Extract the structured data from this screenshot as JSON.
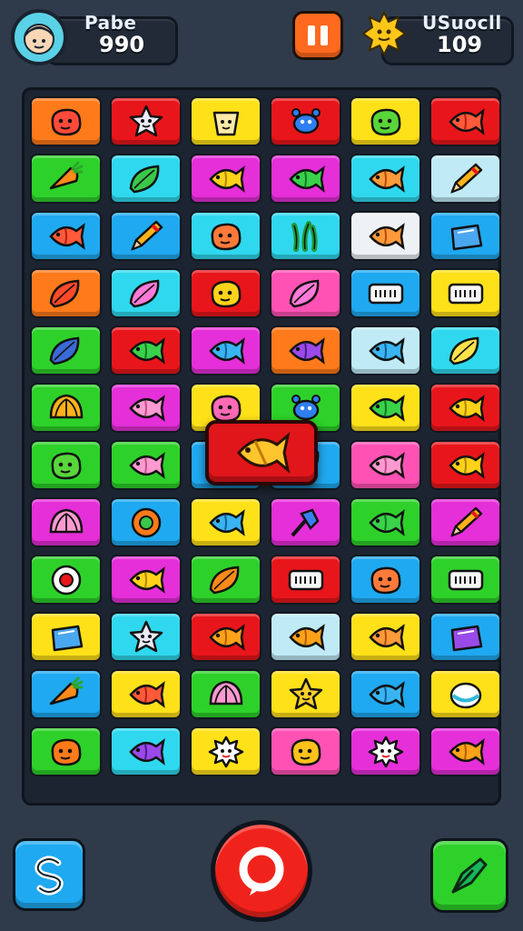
{
  "hud": {
    "player": {
      "name": "Pabe",
      "score": "990",
      "avatar_icon": "player-avatar-icon"
    },
    "pause_icon": "pause-icon",
    "opponent": {
      "name": "USuocll",
      "score": "109",
      "coin_icon": "sun-coin-icon"
    }
  },
  "colors": {
    "background": "#2f3b4b",
    "orange": "#ff7a1a",
    "red": "#e8161b",
    "yellow": "#ffe119",
    "green": "#2ed12a",
    "cyan": "#2fd8ee",
    "blue": "#1fa9f0",
    "magenta": "#e52fd8",
    "pink": "#ff52b4",
    "sky": "#bfeaf6",
    "white": "#eef2f5"
  },
  "board": {
    "rows": 12,
    "cols": 6,
    "tiles": [
      [
        [
          "orange",
          "tomato-icon"
        ],
        [
          "red",
          "paper-star-icon"
        ],
        [
          "yellow",
          "bucket-face-icon"
        ],
        [
          "red",
          "blue-crab-icon"
        ],
        [
          "yellow",
          "green-blob-icon"
        ],
        [
          "red",
          "red-fish-icon"
        ]
      ],
      [
        [
          "green",
          "carrot-icon"
        ],
        [
          "cyan",
          "leaf-fish-icon"
        ],
        [
          "magenta",
          "yellow-fish-icon"
        ],
        [
          "magenta",
          "green-fish-icon"
        ],
        [
          "cyan",
          "salmon-icon"
        ],
        [
          "sky",
          "pencil-icon"
        ]
      ],
      [
        [
          "blue",
          "red-fish-icon"
        ],
        [
          "blue",
          "pencil-icon"
        ],
        [
          "cyan",
          "spotted-fish-icon"
        ],
        [
          "cyan",
          "seaweed-icon"
        ],
        [
          "white",
          "salmon-icon"
        ],
        [
          "blue",
          "blue-bag-icon"
        ]
      ],
      [
        [
          "orange",
          "red-leaf-icon"
        ],
        [
          "cyan",
          "pink-leaf-icon"
        ],
        [
          "red",
          "yellow-face-icon"
        ],
        [
          "pink",
          "pink-leaf-icon"
        ],
        [
          "blue",
          "ticket-icon"
        ],
        [
          "yellow",
          "ticket-icon"
        ]
      ],
      [
        [
          "green",
          "blue-leaf-icon"
        ],
        [
          "red",
          "green-fish-icon"
        ],
        [
          "magenta",
          "blue-fish-icon"
        ],
        [
          "orange",
          "purple-fish-icon"
        ],
        [
          "sky",
          "blue-fish-icon"
        ],
        [
          "cyan",
          "yellow-leaf-icon"
        ]
      ],
      [
        [
          "green",
          "shell-icon"
        ],
        [
          "magenta",
          "pink-fish-icon"
        ],
        [
          "yellow",
          "pink-blob-icon"
        ],
        [
          "green",
          "blue-crab-icon"
        ],
        [
          "yellow",
          "green-fish-icon"
        ],
        [
          "red",
          "yellow-fish-icon"
        ]
      ],
      [
        [
          "green",
          "green-blob-icon"
        ],
        [
          "green",
          "pink-fish-icon"
        ],
        [
          "blue",
          "orange-leaf-icon"
        ],
        [
          "blue",
          "orange-leaf-icon"
        ],
        [
          "pink",
          "pink-fish-icon"
        ],
        [
          "red",
          "yellow-fish-icon"
        ]
      ],
      [
        [
          "magenta",
          "pink-shell-icon"
        ],
        [
          "blue",
          "green-ball-icon"
        ],
        [
          "yellow",
          "blue-fish-icon"
        ],
        [
          "magenta",
          "pin-icon"
        ],
        [
          "green",
          "green-fish-icon"
        ],
        [
          "magenta",
          "pencil-icon"
        ]
      ],
      [
        [
          "green",
          "eye-ball-icon"
        ],
        [
          "magenta",
          "yellow-fish-icon"
        ],
        [
          "green",
          "orange-leaf-icon"
        ],
        [
          "red",
          "ticket-icon"
        ],
        [
          "blue",
          "spotted-fish-icon"
        ],
        [
          "green",
          "ticket-icon"
        ]
      ],
      [
        [
          "yellow",
          "blue-bag-icon"
        ],
        [
          "cyan",
          "paper-star-icon"
        ],
        [
          "red",
          "orange-fish-icon"
        ],
        [
          "sky",
          "orange-fish-icon"
        ],
        [
          "yellow",
          "salmon-icon"
        ],
        [
          "blue",
          "purple-bag-icon"
        ]
      ],
      [
        [
          "blue",
          "carrot-icon"
        ],
        [
          "yellow",
          "red-fish-icon"
        ],
        [
          "green",
          "pink-shell-icon"
        ],
        [
          "yellow",
          "star-face-icon"
        ],
        [
          "blue",
          "blue-fish-icon"
        ],
        [
          "yellow",
          "clam-icon"
        ]
      ],
      [
        [
          "green",
          "orange-blob-icon"
        ],
        [
          "cyan",
          "purple-fish-icon"
        ],
        [
          "yellow",
          "white-spiky-icon"
        ],
        [
          "pink",
          "yellow-blob-icon"
        ],
        [
          "magenta",
          "white-spiky-icon"
        ],
        [
          "magenta",
          "orange-fish-icon"
        ]
      ]
    ]
  },
  "popup": {
    "icon": "golden-fish-icon"
  },
  "controls": {
    "left_icon": "swap-icon",
    "center_icon": "chat-bubble-icon",
    "right_icon": "leaf-arrow-icon"
  }
}
